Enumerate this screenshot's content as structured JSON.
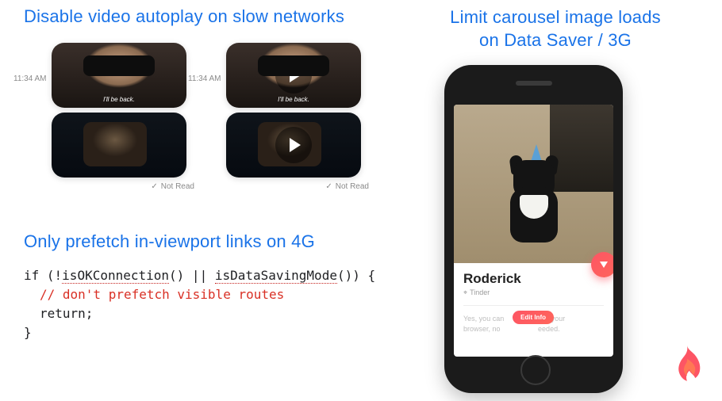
{
  "sections": {
    "autoplay": {
      "heading": "Disable video autoplay on slow networks",
      "timestamp": "11:34 AM",
      "caption": "I'll be back.",
      "not_read": "Not Read"
    },
    "prefetch": {
      "heading": "Only prefetch in-viewport links on 4G",
      "code": {
        "l1_if": "if",
        "l1_open": " (!",
        "l1_fn1": "isOKConnection",
        "l1_mid": "() || ",
        "l1_fn2": "isDataSavingMode",
        "l1_close": "()) {",
        "l2_comment": "// don't prefetch visible routes",
        "l3_return": "return",
        "l3_semi": ";",
        "l4_brace": "}"
      }
    },
    "carousel": {
      "heading_l1": "Limit carousel image loads",
      "heading_l2": "on Data Saver / 3G",
      "card": {
        "name": "Roderick",
        "subtitle": "Tinder",
        "blurb_before": "Yes, you can",
        "blurb_after": "in your",
        "blurb_line2": "browser, no",
        "blurb_line2_after": "eeded.",
        "edit": "Edit Info"
      }
    }
  }
}
